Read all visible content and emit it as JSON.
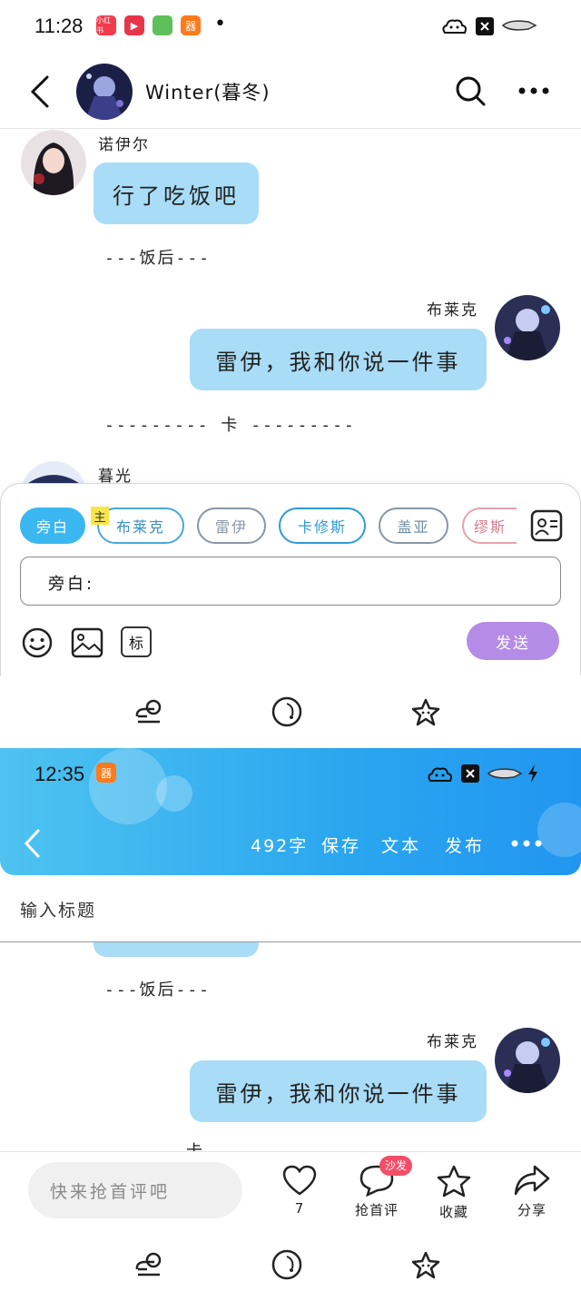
{
  "top_status": {
    "time": "11:28",
    "apps": [
      "小红书",
      "▶",
      "",
      "器"
    ],
    "dot": "•"
  },
  "chat_header": {
    "title": "Winter(暮冬)"
  },
  "messages": {
    "m1_name": "诺伊尔",
    "m1_text": "行了吃饭吧",
    "scene1": "---饭后---",
    "m2_name": "布莱克",
    "m2_text": "雷伊，我和你说一件事",
    "scene2": "--------- 卡 ---------",
    "m3_name": "暮光"
  },
  "composer": {
    "roles": [
      "旁白",
      "布莱克",
      "雷伊",
      "卡修斯",
      "盖亚",
      "缪斯"
    ],
    "role_badge": "主",
    "input_prefix": "旁白:",
    "tool_mark": "标",
    "send": "发送"
  },
  "editor_status": {
    "time": "12:35"
  },
  "editor_header": {
    "word_count": "492字",
    "save": "保存",
    "text": "文本",
    "publish": "发布"
  },
  "editor_title_placeholder": "输入标题",
  "preview": {
    "scene1": "---饭后---",
    "m2_name": "布莱克",
    "m2_text": "雷伊，我和你说一件事",
    "scene2": "卡"
  },
  "comment_bar": {
    "placeholder": "快来抢首评吧",
    "like_count": "7",
    "comment_label": "抢首评",
    "sofa_badge": "沙发",
    "favorite_label": "收藏",
    "share_label": "分享"
  },
  "colors": {
    "bubble": "#a9dcf6",
    "accent_blue": "#3aa4e8",
    "send_purple": "#b48be6"
  }
}
